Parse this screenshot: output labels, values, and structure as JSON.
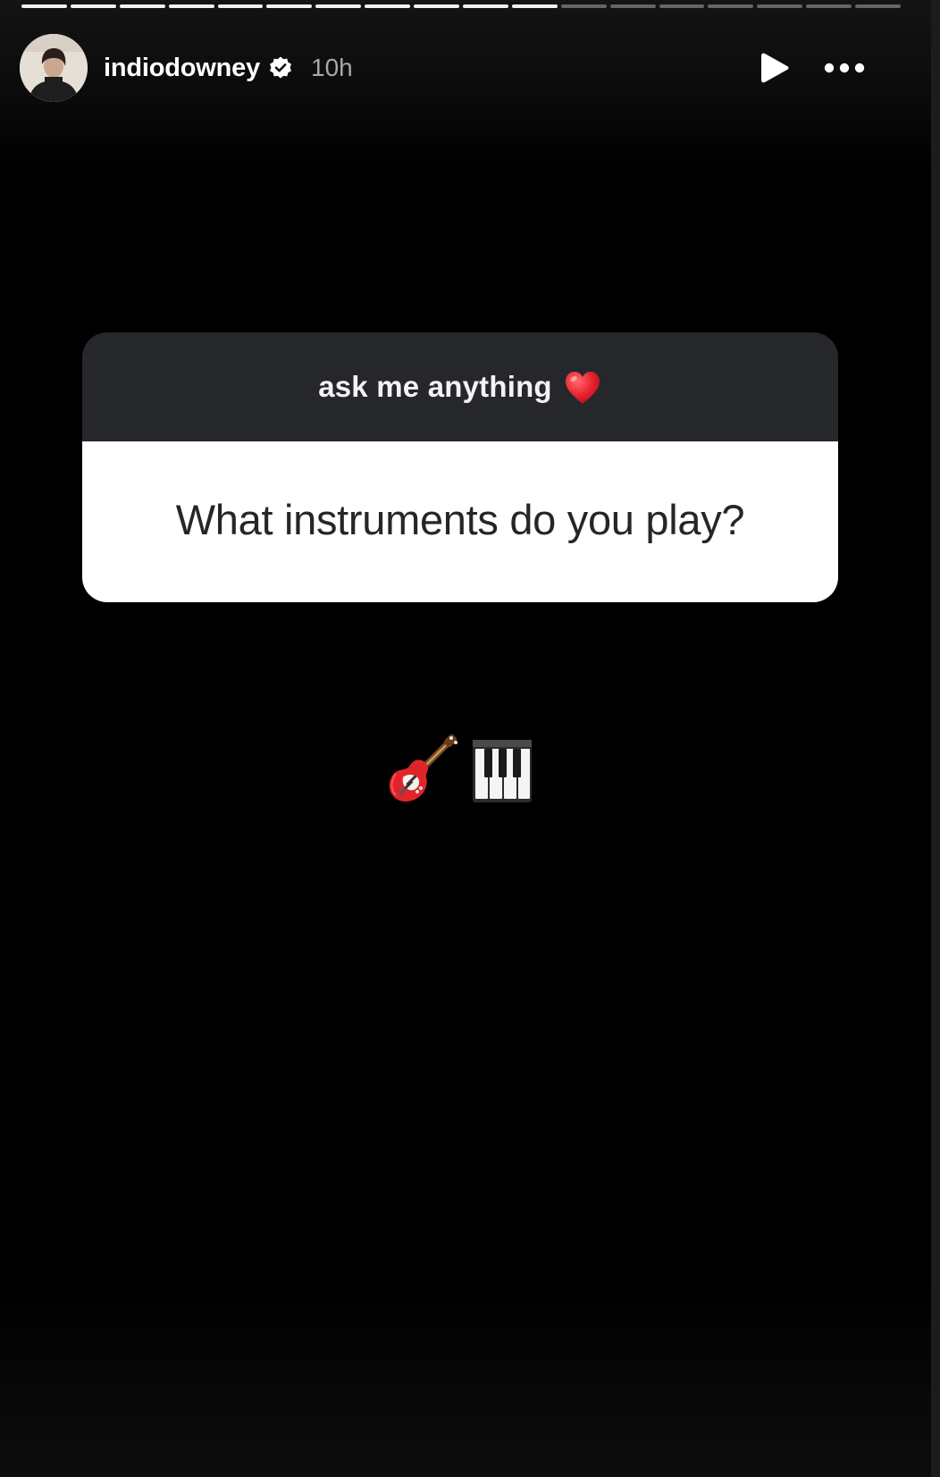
{
  "story": {
    "progress": {
      "total_segments": 18,
      "completed_segments": 11
    },
    "user": {
      "username": "indiodowney",
      "verified": true,
      "timestamp": "10h",
      "avatar_icon": "profile-photo"
    },
    "actions": {
      "play_icon": "play-icon",
      "more_icon": "more-options-icon"
    }
  },
  "question_sticker": {
    "prompt": "ask me anything",
    "prompt_emoji": "red-heart",
    "question": "What instruments do you play?",
    "header_color": "#26272b",
    "body_color": "#ffffff"
  },
  "answer": {
    "emojis": [
      "guitar",
      "musical-keyboard"
    ]
  }
}
